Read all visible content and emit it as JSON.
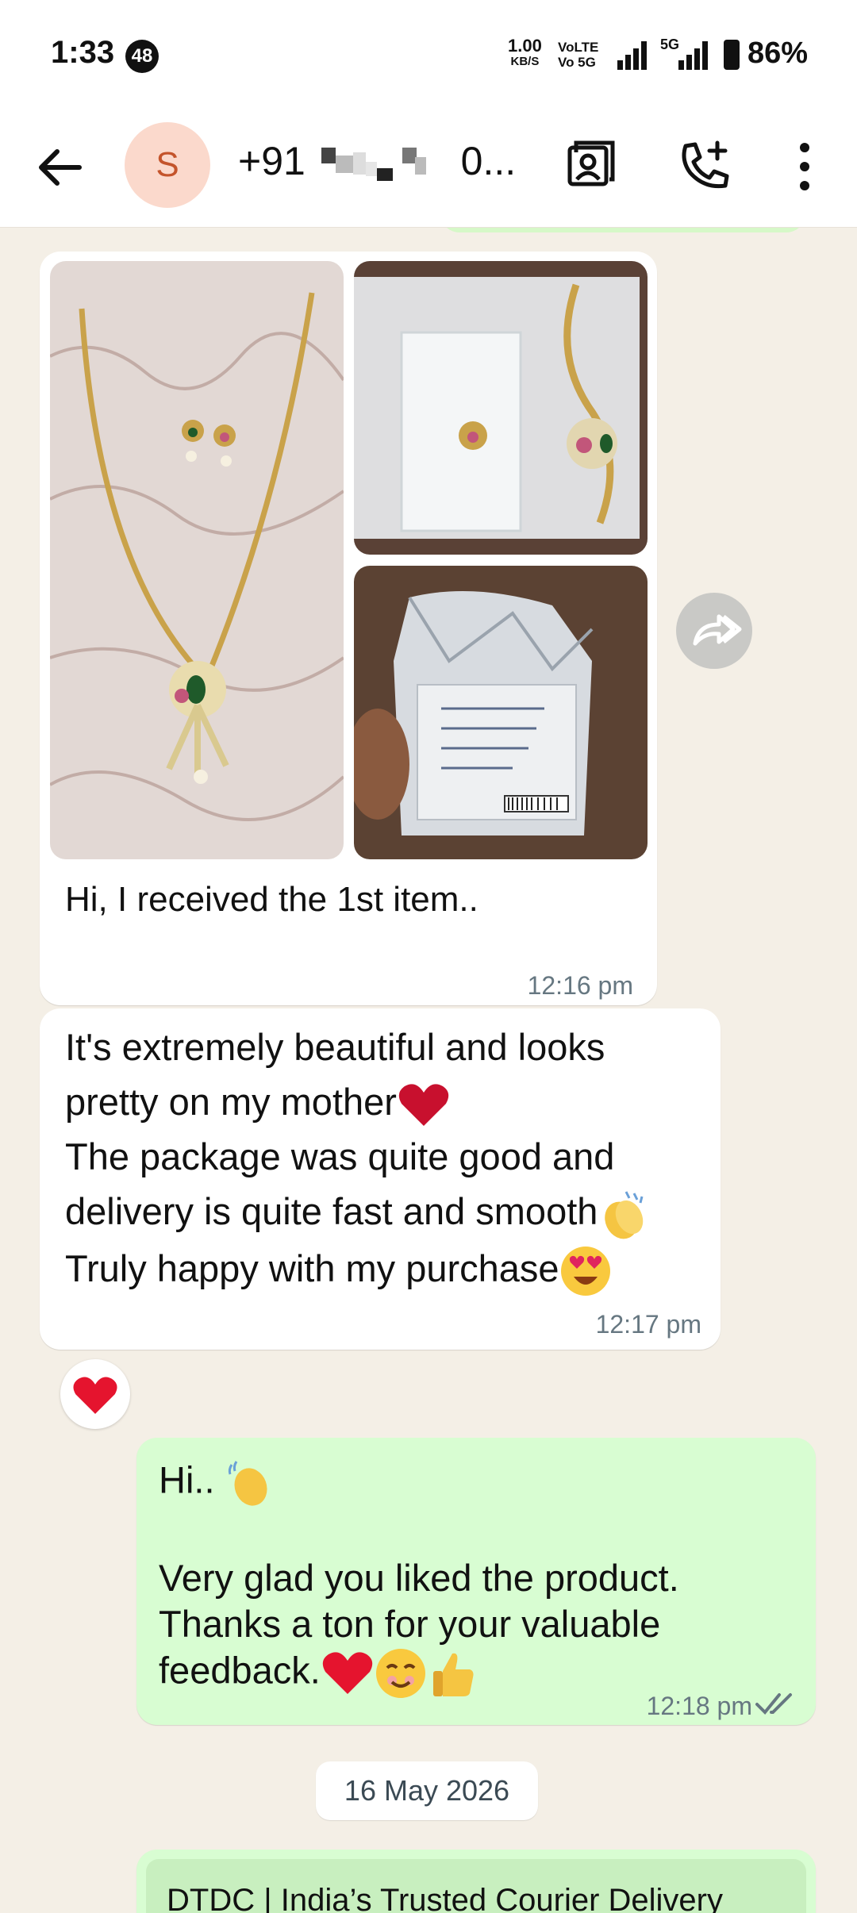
{
  "status_bar": {
    "time": "1:33",
    "notification_count": "48",
    "net_speed_value": "1.00",
    "net_speed_unit": "KB/S",
    "volte_line1": "VoLTE",
    "volte_line2": "Vo 5G",
    "network_label": "5G",
    "battery": "86%"
  },
  "app_bar": {
    "avatar_letter": "S",
    "contact_prefix": "+91",
    "contact_suffix": "0..."
  },
  "messages": {
    "album_caption": "Hi, I received the 1st item..",
    "album_time": "12:16 pm",
    "msg2_lines": [
      "It's extremely beautiful and looks",
      "pretty on my mother",
      "The package was quite good and",
      "delivery is quite fast and smooth",
      "Truly happy with my purchase"
    ],
    "msg2_time": "12:17 pm",
    "msg3_lines": [
      "Hi..",
      "",
      "Very glad you liked the product.",
      "Thanks a ton for your valuable",
      "feedback."
    ],
    "msg3_time": "12:18 pm",
    "date_chip": "16 May 2026",
    "link_title": "DTDC | India’s Trusted Courier Delivery"
  },
  "colors": {
    "incoming_bubble": "#ffffff",
    "outgoing_bubble": "#d8fdd2",
    "chat_background": "#f4efe6",
    "timestamp": "#667781",
    "avatar_bg": "#fbd9cc",
    "avatar_fg": "#c4542b"
  },
  "icons": {
    "back": "arrow-left-icon",
    "contacts": "contact-card-icon",
    "add_call": "phone-plus-icon",
    "more": "more-vertical-icon",
    "forward": "forward-icon",
    "read": "double-check-icon",
    "heart": "red-heart-icon",
    "clap": "clapping-hands-icon",
    "heart_eyes": "heart-eyes-emoji-icon",
    "wave": "waving-hand-icon",
    "smile": "smiling-face-icon",
    "thumbs_up": "thumbs-up-icon"
  }
}
